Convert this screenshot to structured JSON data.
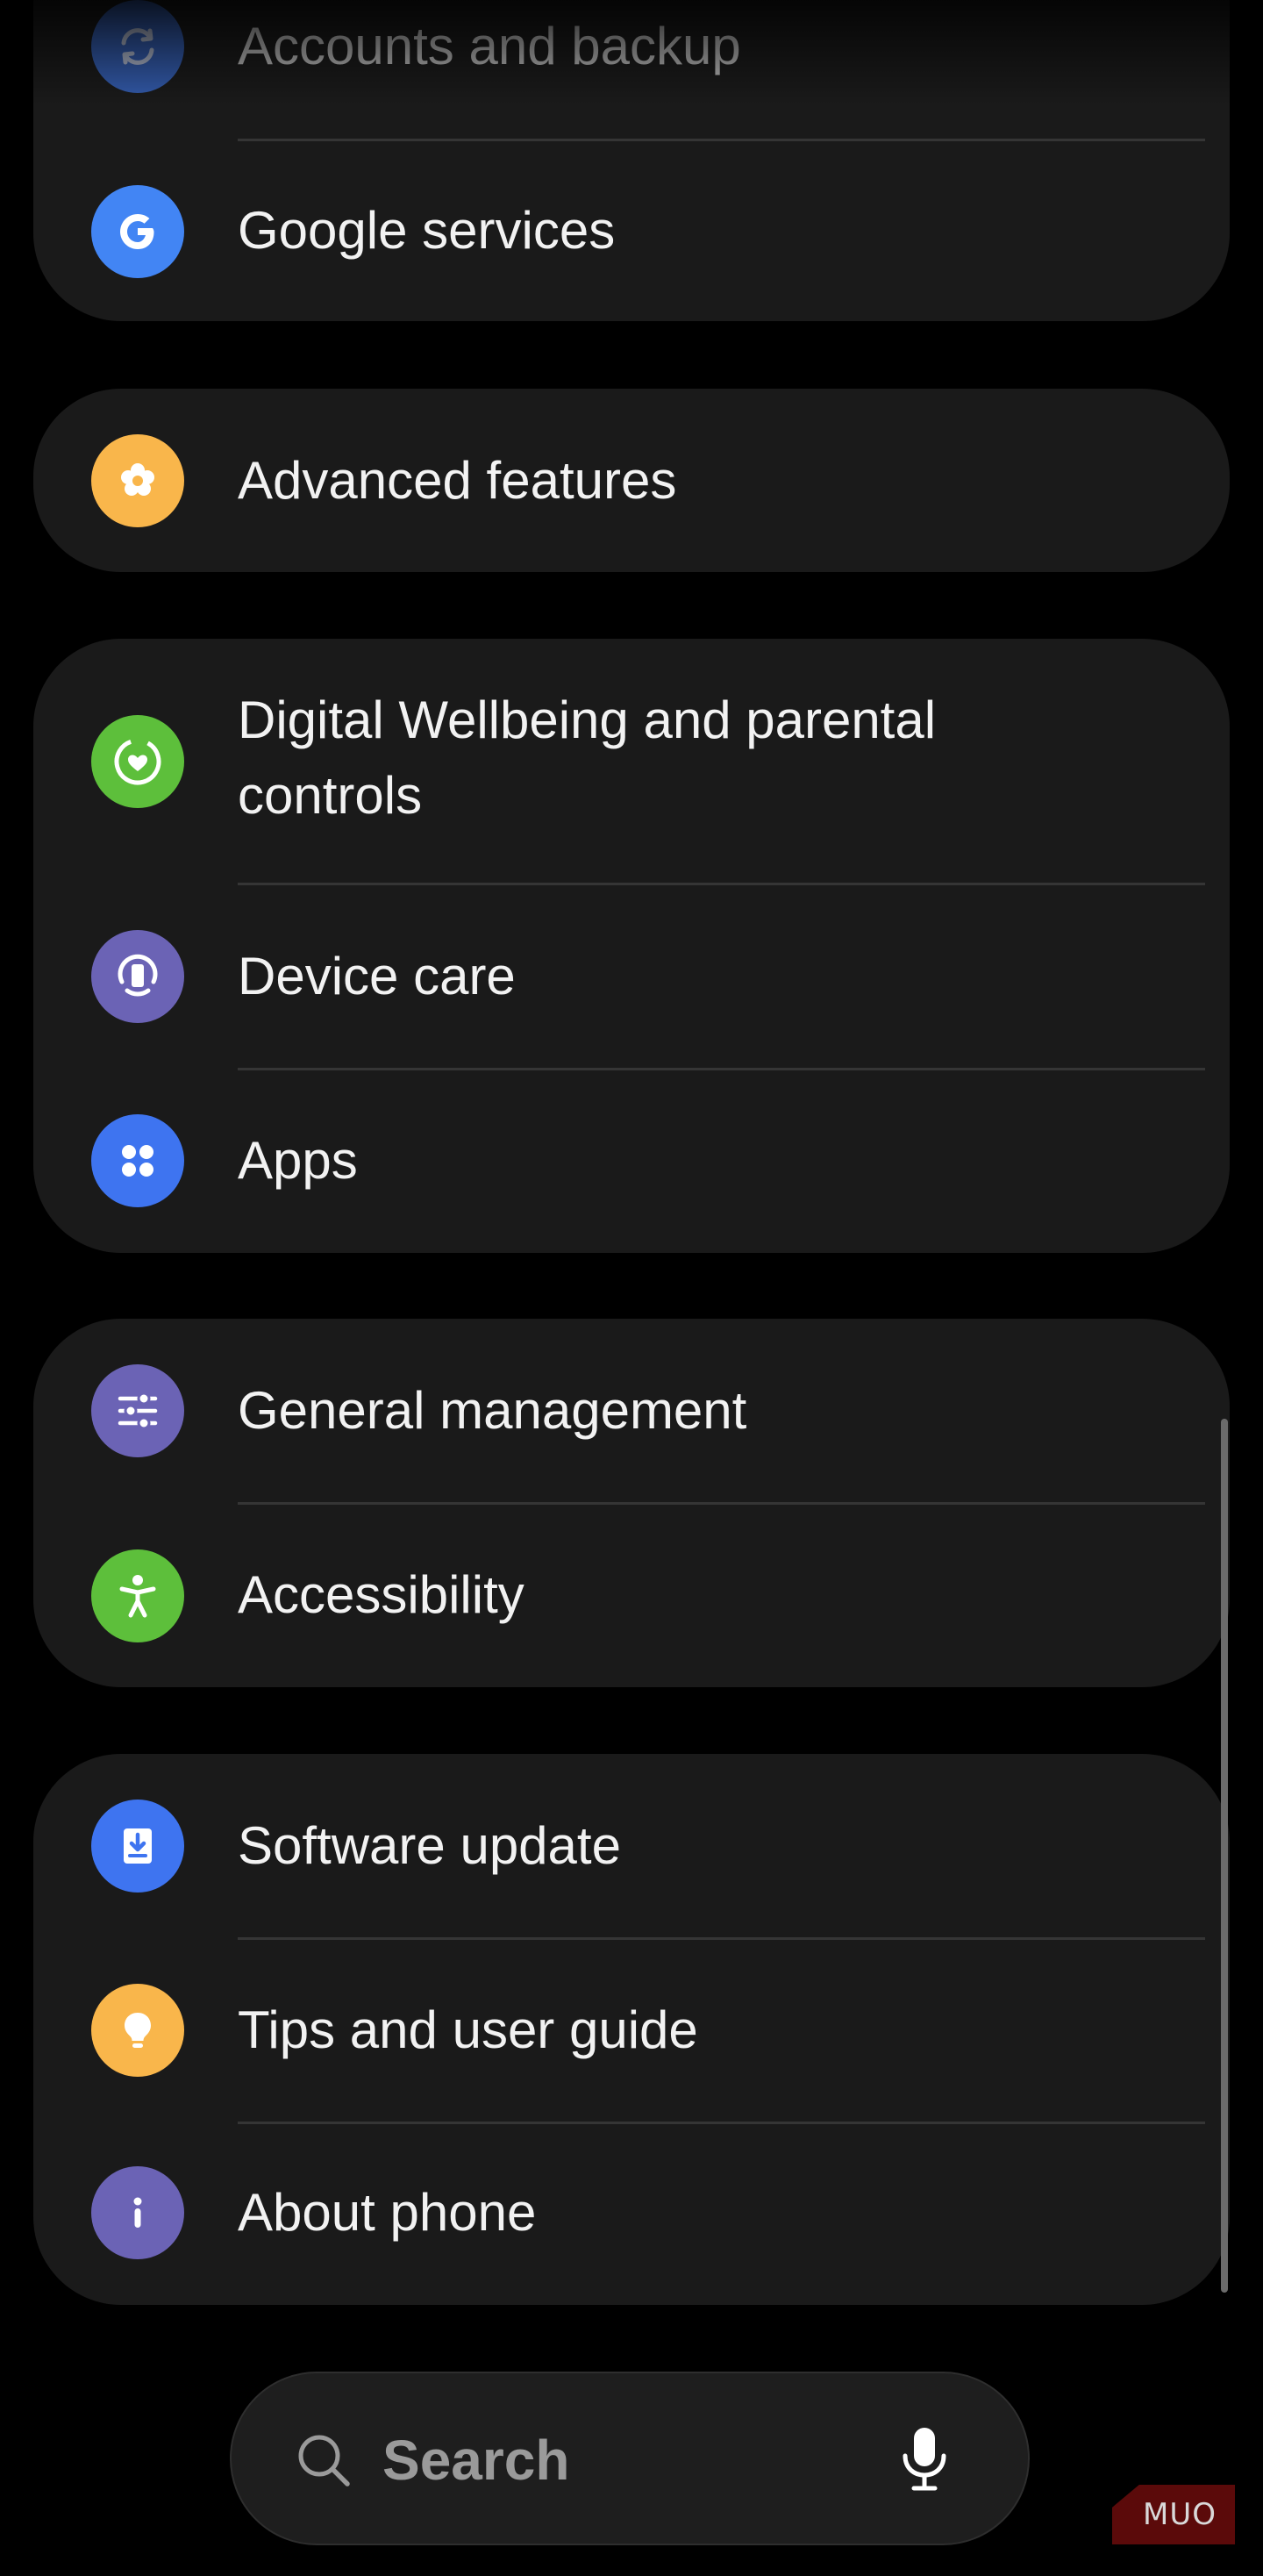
{
  "settings": {
    "groups": [
      {
        "items": [
          {
            "label": "Accounts and backup",
            "icon": "sync-icon",
            "color": "#3b6fd8"
          },
          {
            "label": "Google services",
            "icon": "google-g-icon",
            "color": "#4285f4"
          }
        ]
      },
      {
        "items": [
          {
            "label": "Advanced features",
            "icon": "gear-flower-icon",
            "color": "#f9b64b"
          }
        ]
      },
      {
        "items": [
          {
            "label": "Digital Wellbeing and parental controls",
            "icon": "heart-circle-icon",
            "color": "#5dbf3b"
          },
          {
            "label": "Device care",
            "icon": "device-care-icon",
            "color": "#6b63b5"
          },
          {
            "label": "Apps",
            "icon": "apps-grid-icon",
            "color": "#3e74f0"
          }
        ]
      },
      {
        "items": [
          {
            "label": "General management",
            "icon": "sliders-icon",
            "color": "#6b63b5"
          },
          {
            "label": "Accessibility",
            "icon": "accessibility-person-icon",
            "color": "#5dbf3b"
          }
        ]
      },
      {
        "items": [
          {
            "label": "Software update",
            "icon": "download-icon",
            "color": "#3e74f0"
          },
          {
            "label": "Tips and user guide",
            "icon": "lightbulb-icon",
            "color": "#f9b64b"
          },
          {
            "label": "About phone",
            "icon": "info-icon",
            "color": "#6b63b5"
          }
        ]
      }
    ]
  },
  "search": {
    "label": "Search",
    "icon": "search-icon",
    "mic_icon": "microphone-icon"
  },
  "watermark": {
    "text": "MUO"
  }
}
